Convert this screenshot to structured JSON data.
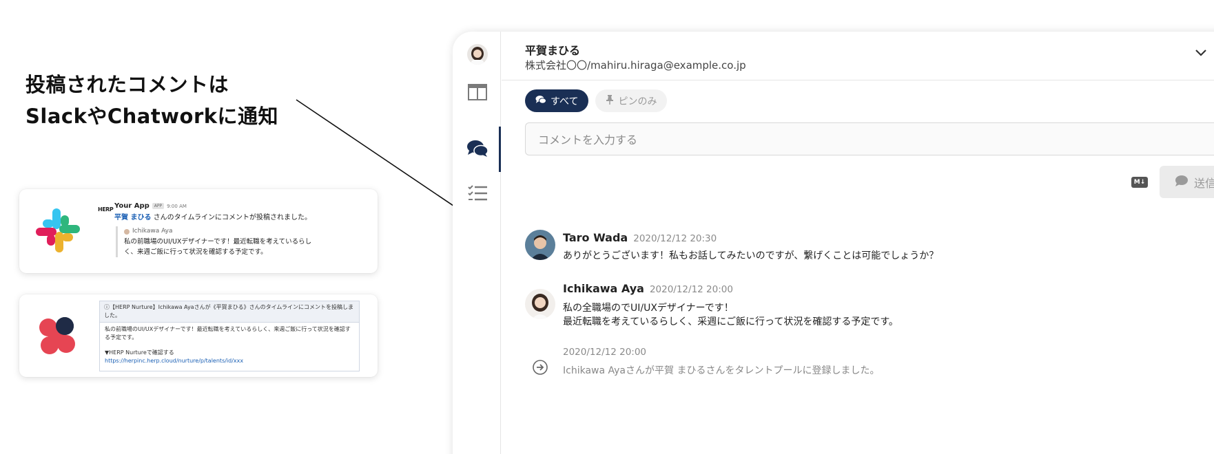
{
  "headline": {
    "line1": "投稿されたコメントは",
    "line2": "SlackやChatworkに通知"
  },
  "slack_card": {
    "tag": "HERP",
    "app_name": "Your App",
    "badge": "APP",
    "time": "9:00 AM",
    "mention": "平賀 まひる",
    "message": " さんのタイムラインにコメントが投稿されました。",
    "quote_user": "Ichikawa Aya",
    "quote_line1": "私の前職場のUI/UXデザイナーです！最近転職を考えているらし",
    "quote_line2": "く、来週ご飯に行って状況を確認する予定です。"
  },
  "chatwork_card": {
    "title": "ⓘ【HERP Nurture】Ichikawa Ayaさんが《平賀まひる》さんのタイムラインにコメントを投稿しました。",
    "body_line1": "私の前職場のUI/UXデザイナーです！最近転職を考えているらしく、来週ご飯に行って状況を確認する予定です。",
    "body_line2": "▼HERP Nurtureで確認する",
    "link": "https://herpinc.herp.cloud/nurture/p/talents/id/xxx"
  },
  "header": {
    "name": "平賀まひる",
    "subtitle": "株式会社〇〇/mahiru.hiraga@example.co.jp"
  },
  "tabs": [
    {
      "label": "すべて",
      "icon": "comments-icon",
      "active": true
    },
    {
      "label": "ピンのみ",
      "icon": "pin-icon",
      "active": false
    }
  ],
  "comment_input": {
    "placeholder": "コメントを入力する"
  },
  "toolbar": {
    "markdown_label": "M↓",
    "send_label": "送信"
  },
  "timeline": [
    {
      "author": "Taro Wada",
      "time": "2020/12/12 20:30",
      "text": "ありがとうございます！私もお話してみたいのですが、繋げくことは可能でしょうか？"
    },
    {
      "author": "Ichikawa Aya",
      "time": "2020/12/12 20:00",
      "text_line1": "私の全職場のでUI/UXデザイナーです！",
      "text_line2": "最近転職を考えているらしく、采週にご飯に行って状況を確認する予定です。"
    },
    {
      "type": "system",
      "time": "2020/12/12 20:00",
      "text": "Ichikawa Ayaさんが平賀 まひるさんをタレントプールに登録しました。"
    }
  ],
  "colors": {
    "navy": "#1a2f55",
    "link_blue": "#1a5fb4",
    "slack_blue": "#36c5f0",
    "slack_green": "#2eb67d",
    "slack_yellow": "#ecb22e",
    "slack_red": "#e01e5a",
    "chatwork_red": "#e64553",
    "chatwork_navy": "#1f2b46"
  }
}
